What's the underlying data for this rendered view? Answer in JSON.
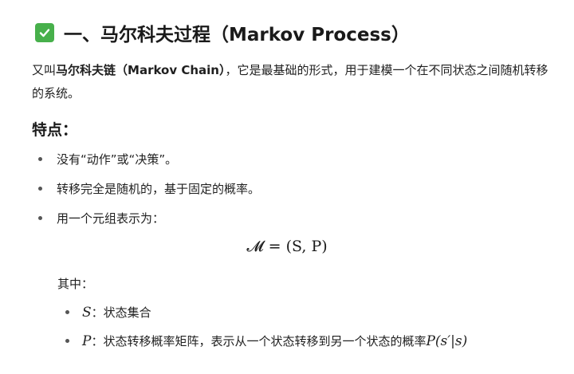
{
  "heading": {
    "icon": "check-mark-icon",
    "icon_color": "#47b04b",
    "title": "一、马尔科夫过程（Markov Process）"
  },
  "intro": {
    "prefix": "又叫",
    "term": "马尔科夫链（Markov Chain）",
    "suffix": "，它是最基础的形式，用于建模一个在不同状态之间随机转移的系统。"
  },
  "features": {
    "title": "特点：",
    "items": [
      "没有“动作”或“决策”。",
      "转移完全是随机的，基于固定的概率。",
      "用一个元组表示为："
    ]
  },
  "formula": "𝓜 = (S, P)",
  "where": {
    "label": "其中：",
    "items": [
      {
        "symbol": "S",
        "text": "：状态集合"
      },
      {
        "symbol": "P",
        "text": "：状态转移概率矩阵，表示从一个状态转移到另一个状态的概率 ",
        "expr": "P(s′|s)"
      }
    ]
  }
}
